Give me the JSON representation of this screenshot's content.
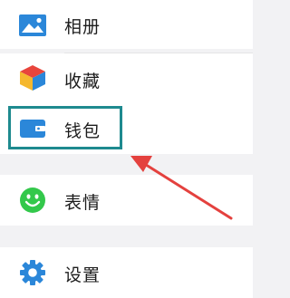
{
  "menu": {
    "items": [
      {
        "label": "相册",
        "icon": "photo-album-icon"
      },
      {
        "label": "收藏",
        "icon": "favorites-cube-icon"
      },
      {
        "label": "钱包",
        "icon": "wallet-icon"
      },
      {
        "label": "表情",
        "icon": "emoji-icon"
      },
      {
        "label": "设置",
        "icon": "settings-gear-icon"
      }
    ]
  },
  "colors": {
    "accent_blue": "#2b87d9",
    "emoji_green": "#33c84b",
    "highlight": "#1e8a8f",
    "arrow": "#e4413e"
  }
}
